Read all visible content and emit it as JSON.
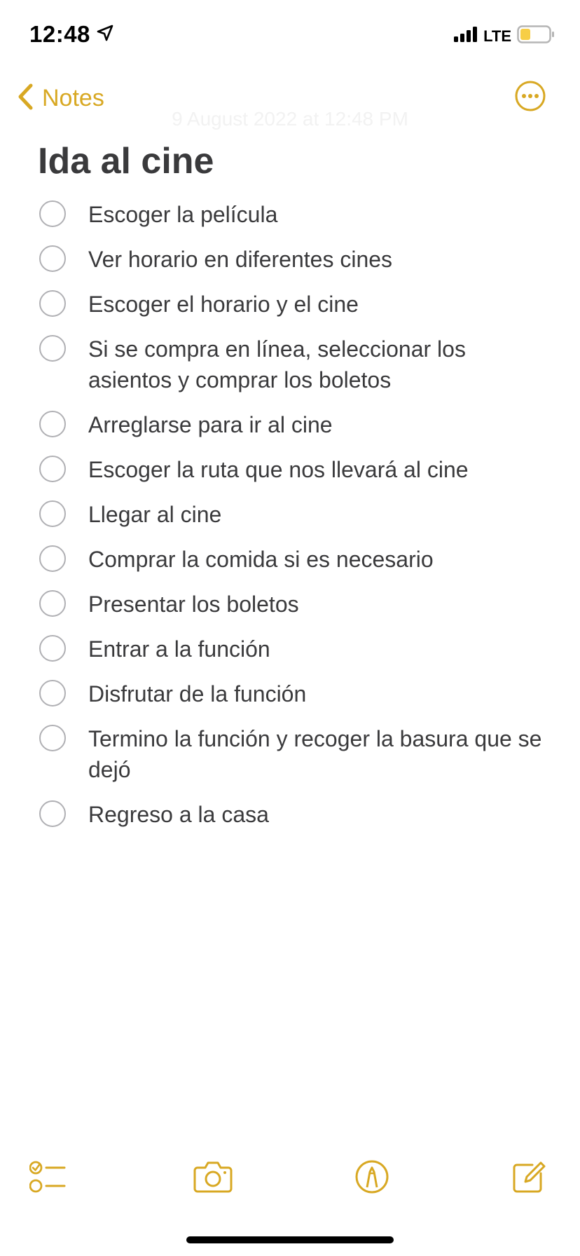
{
  "status_bar": {
    "time": "12:48",
    "network": "LTE"
  },
  "nav": {
    "back_label": "Notes",
    "date": "9 August 2022 at 12:48 PM"
  },
  "note": {
    "title": "Ida al cine",
    "items": [
      "Escoger la película",
      "Ver horario en diferentes cines",
      "Escoger el horario y el cine",
      "Si se compra en línea, seleccionar los asientos y comprar los boletos",
      "Arreglarse para ir al cine",
      "Escoger la ruta que nos llevará al cine",
      "Llegar al cine",
      "Comprar la comida si es necesario",
      "Presentar los boletos",
      "Entrar a la función",
      "Disfrutar de la función",
      "Termino la función y recoger la basura que se dejó",
      "Regreso a la casa"
    ]
  },
  "colors": {
    "accent": "#d8a823",
    "text": "#3a3a3c",
    "circle": "#b0b0b4",
    "battery_fill": "#f7ce46"
  },
  "icons": {
    "location": "location-arrow-icon",
    "signal": "cellular-signal-icon",
    "battery": "battery-icon",
    "back": "chevron-left-icon",
    "more": "ellipsis-circle-icon",
    "checklist": "checklist-icon",
    "camera": "camera-icon",
    "markup": "markup-pen-icon",
    "compose": "compose-icon"
  }
}
